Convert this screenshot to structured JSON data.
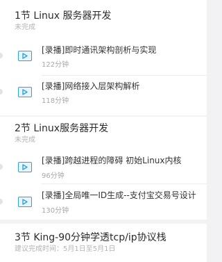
{
  "sections": [
    {
      "title": "1节  Linux 服务器开发",
      "status": "未完成",
      "lessons": [
        {
          "title": "[录播]即时通讯架构剖析与实现",
          "duration": "122分钟"
        },
        {
          "title": "[录播]网络接入层架构解析",
          "duration": "118分钟"
        }
      ]
    },
    {
      "title": "2节  Linux服务器开发",
      "status": "未完成",
      "lessons": [
        {
          "title": "[录播]跨越进程的障碍 初始Linux内核",
          "duration": "96分钟"
        },
        {
          "title": "[录播]全局唯一ID生成--支付宝交易号设计",
          "duration": "130分钟"
        }
      ]
    },
    {
      "title": "3节  King-90分钟学透tcp/ip协议栈",
      "status": "建议完成时间：5月1日至5月1日",
      "lessons": []
    }
  ],
  "colors": {
    "accent": "#2ea3d8",
    "background": "#f2f2f4",
    "card": "#ffffff",
    "muted_text": "#b4b4b4"
  },
  "icons": [
    "play-video-icon"
  ]
}
